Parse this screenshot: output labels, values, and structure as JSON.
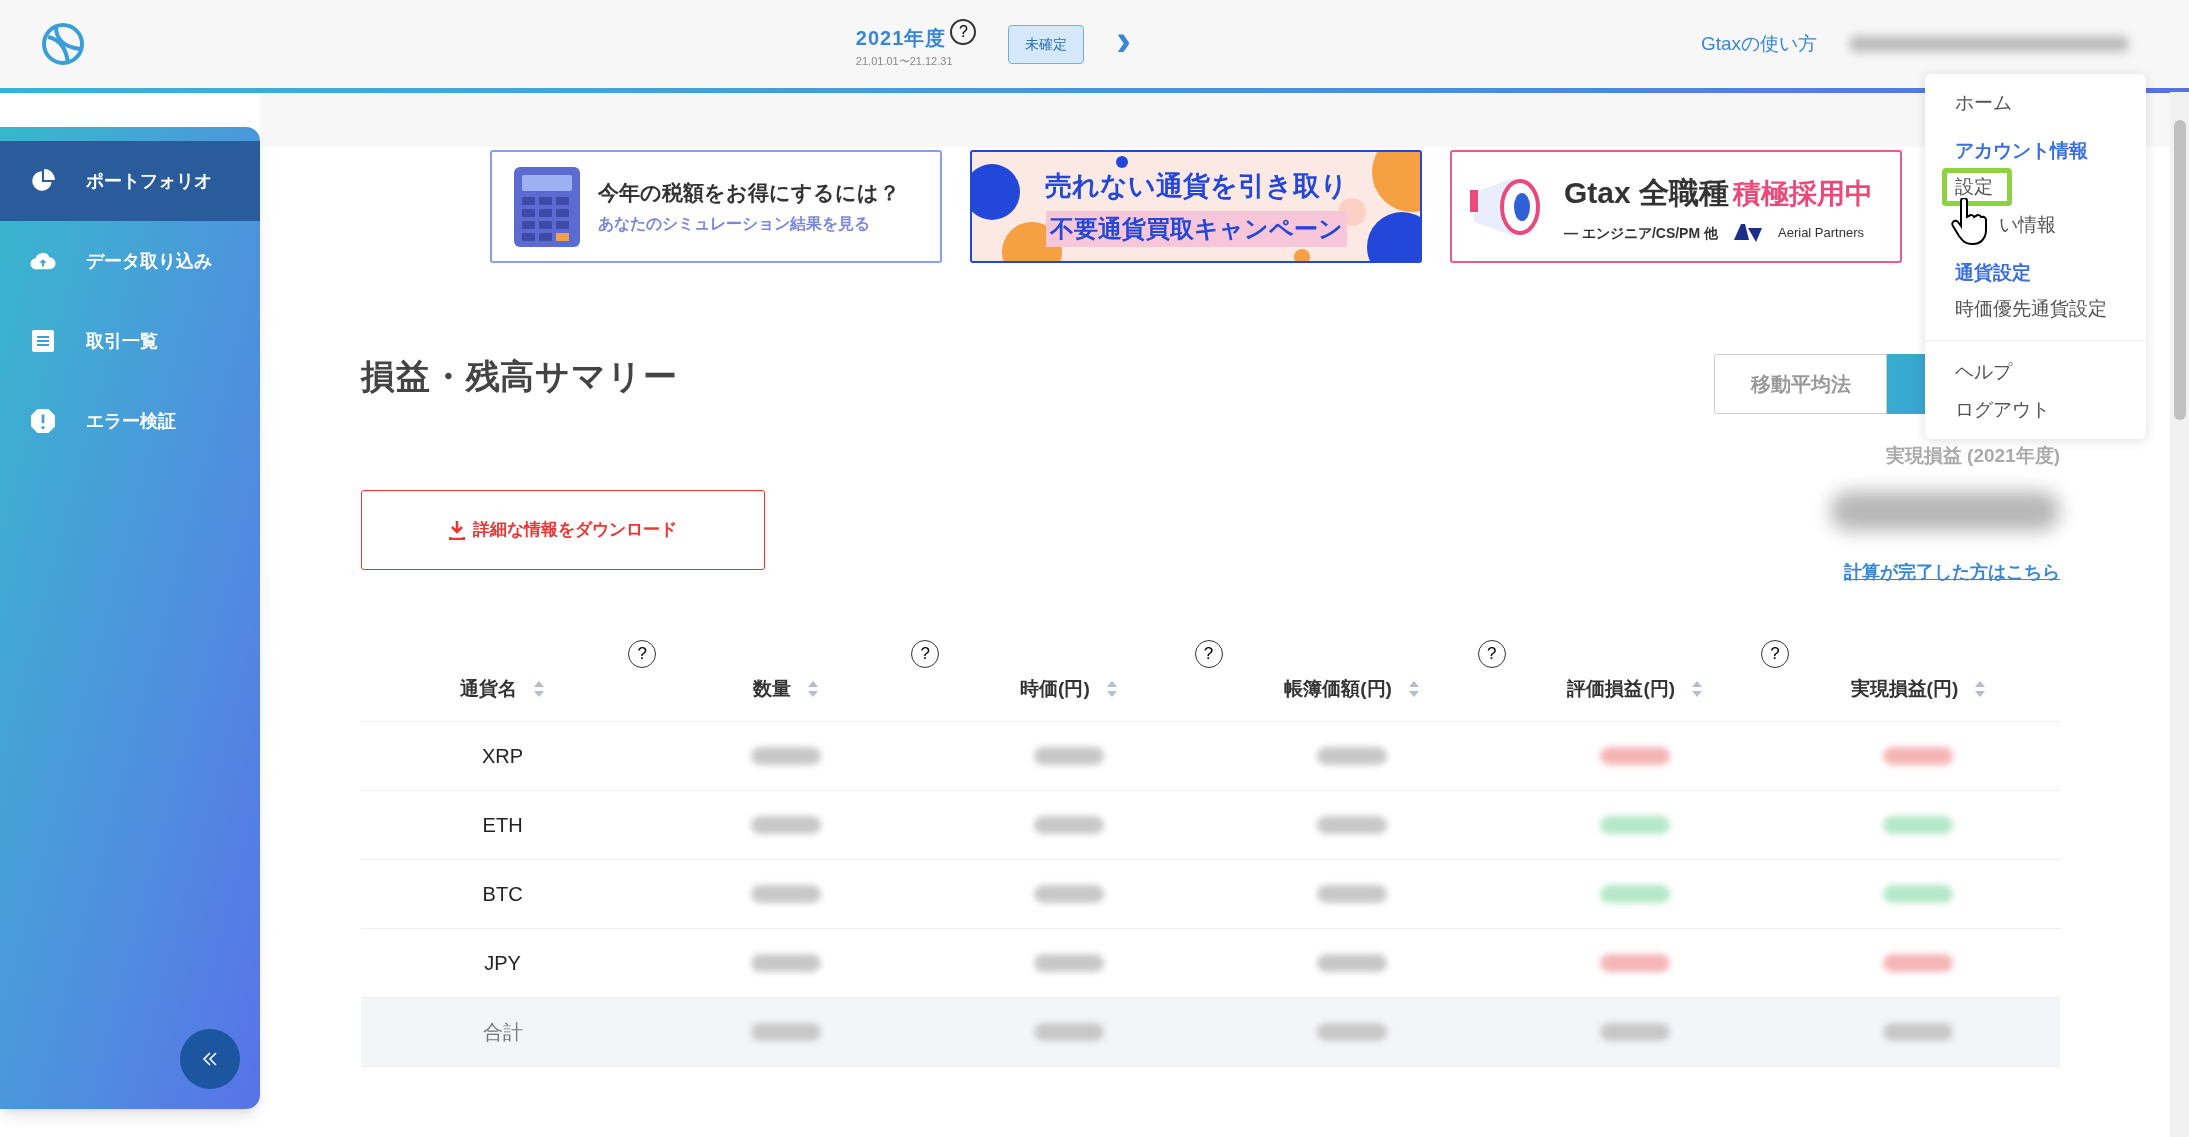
{
  "header": {
    "year": "2021年度",
    "help": "?",
    "period": "21.01.01〜21.12.31",
    "status_badge": "未確定",
    "next": "›",
    "guide_link": "Gtaxの使い方"
  },
  "sidebar": {
    "items": [
      {
        "label": "ポートフォリオ",
        "kind": "pie",
        "selected": true
      },
      {
        "label": "データ取り込み",
        "kind": "upload",
        "selected": false
      },
      {
        "label": "取引一覧",
        "kind": "list",
        "selected": false
      },
      {
        "label": "エラー検証",
        "kind": "alert",
        "selected": false
      }
    ]
  },
  "banners": [
    {
      "kind": "calc",
      "title": "今年の税額をお得にするには？",
      "subtitle": "あなたのシミュレーション結果を見る"
    },
    {
      "kind": "campaign",
      "title": "売れない通貨を引き取り",
      "subtitle": "不要通貨買取キャンペーン"
    },
    {
      "kind": "recruit",
      "title": "Gtax 全職種",
      "highlight": "積極採用中",
      "subtitle": "— エンジニア/CS/PM 他",
      "partner": "Aerial Partners"
    }
  ],
  "summary": {
    "title": "損益・残高サマリー",
    "download_button": "詳細な情報をダウンロード",
    "method_toggle": [
      {
        "label": "移動平均法",
        "selected": false
      },
      {
        "selected": true
      }
    ],
    "realized_label": "実現損益 (2021年度)",
    "completed_link": "計算が完了した方はこちら"
  },
  "table": {
    "columns": [
      {
        "label": "通貨名"
      },
      {
        "label": "数量",
        "help": "?"
      },
      {
        "label": "時価(円)",
        "help": "?"
      },
      {
        "label": "帳簿価額(円)",
        "help": "?"
      },
      {
        "label": "評価損益(円)",
        "help": "?"
      },
      {
        "label": "実現損益(円)",
        "help": "?"
      }
    ],
    "rows": [
      {
        "name": "XRP",
        "total": false,
        "cells": [
          {
            "color": "#c8c8c8"
          },
          {
            "color": "#c8c8c8"
          },
          {
            "color": "#c8c8c8"
          },
          {
            "color": "#f5b5b5"
          },
          {
            "color": "#f5b5b5"
          }
        ]
      },
      {
        "name": "ETH",
        "total": false,
        "cells": [
          {
            "color": "#c8c8c8"
          },
          {
            "color": "#c8c8c8"
          },
          {
            "color": "#c8c8c8"
          },
          {
            "color": "#b5e8c8"
          },
          {
            "color": "#b5e8c8"
          }
        ]
      },
      {
        "name": "BTC",
        "total": false,
        "cells": [
          {
            "color": "#c8c8c8"
          },
          {
            "color": "#c8c8c8"
          },
          {
            "color": "#c8c8c8"
          },
          {
            "color": "#b5e8c8"
          },
          {
            "color": "#b5e8c8"
          }
        ]
      },
      {
        "name": "JPY",
        "total": false,
        "cells": [
          {
            "color": "#c8c8c8"
          },
          {
            "color": "#c8c8c8"
          },
          {
            "color": "#c8c8c8"
          },
          {
            "color": "#f5b5b5"
          },
          {
            "color": "#f5b5b5"
          }
        ]
      },
      {
        "name": "合計",
        "total": true,
        "cells": [
          {
            "color": "#c8c8c8"
          },
          {
            "color": "#c8c8c8"
          },
          {
            "color": "#c8c8c8"
          },
          {
            "color": "#c8c8c8"
          },
          {
            "color": "#c8c8c8"
          }
        ]
      }
    ]
  },
  "account_menu": {
    "items": [
      {
        "label": "ホーム",
        "kind": "link",
        "highlighted": false
      },
      {
        "label": "アカウント情報",
        "kind": "heading",
        "highlighted": false
      },
      {
        "label": "設定",
        "kind": "link",
        "highlighted": true
      },
      {
        "label": "い情報",
        "kind": "link",
        "highlighted": false
      },
      {
        "label": "通貨設定",
        "kind": "heading",
        "highlighted": false
      },
      {
        "label": "時価優先通貨設定",
        "kind": "link",
        "highlighted": false
      },
      {
        "kind": "divider"
      },
      {
        "label": "ヘルプ",
        "kind": "link",
        "highlighted": false
      },
      {
        "label": "ログアウト",
        "kind": "link",
        "highlighted": false
      }
    ]
  }
}
